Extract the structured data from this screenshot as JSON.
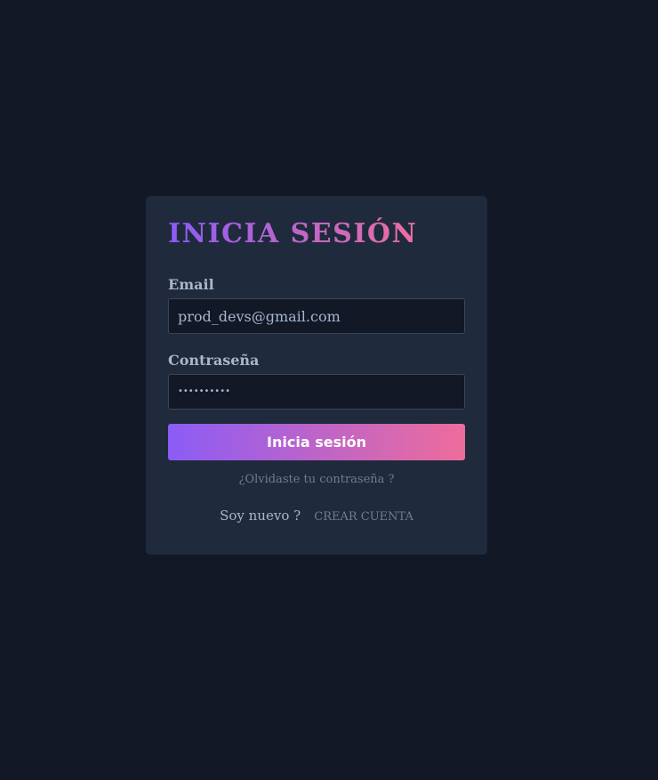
{
  "login": {
    "title": "INICIA SESIÓN",
    "email_label": "Email",
    "email_value": "prod_devs@gmail.com",
    "password_label": "Contraseña",
    "password_value": "••••••••••",
    "submit_label": "Inicia sesión",
    "forgot_link": "¿Olvidaste tu contraseña ?",
    "new_user_text": "Soy nuevo ?",
    "create_account_link": "CREAR CUENTA"
  },
  "colors": {
    "background": "#121826",
    "card": "#1f2a3c",
    "gradient_start": "#8b5cf6",
    "gradient_end": "#ee6c9b",
    "label_text": "#a9b6cb",
    "muted_link": "#6d7d96"
  }
}
